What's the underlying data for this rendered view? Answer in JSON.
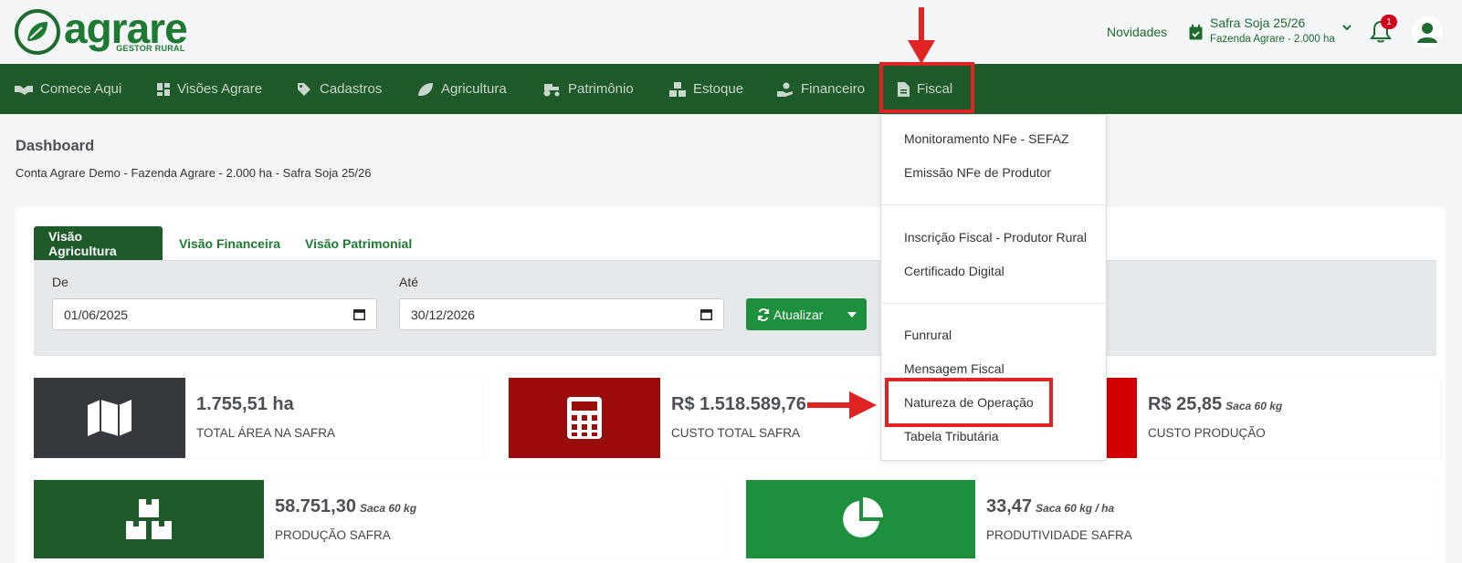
{
  "brand": {
    "name": "agrare",
    "tagline": "GESTOR RURAL"
  },
  "header": {
    "novidades": "Novidades",
    "safra": {
      "title": "Safra Soja 25/26",
      "farm": "Fazenda Agrare - 2.000 ha"
    },
    "notifications_count": "1"
  },
  "nav": {
    "items": [
      {
        "label": "Comece Aqui",
        "icon": "handshake-icon"
      },
      {
        "label": "Visões Agrare",
        "icon": "grid-icon"
      },
      {
        "label": "Cadastros",
        "icon": "tags-icon"
      },
      {
        "label": "Agricultura",
        "icon": "leaf-icon"
      },
      {
        "label": "Patrimônio",
        "icon": "tractor-icon"
      },
      {
        "label": "Estoque",
        "icon": "boxes-icon"
      },
      {
        "label": "Financeiro",
        "icon": "hand-money-icon"
      },
      {
        "label": "Fiscal",
        "icon": "file-invoice-icon"
      }
    ]
  },
  "fiscal_menu": {
    "groups": [
      [
        "Monitoramento NFe - SEFAZ",
        "Emissão NFe de Produtor"
      ],
      [
        "Inscrição Fiscal - Produtor Rural",
        "Certificado Digital"
      ],
      [
        "Funrural",
        "Mensagem Fiscal",
        "Natureza de Operação",
        "Tabela Tributária"
      ]
    ]
  },
  "page": {
    "title": "Dashboard",
    "subtitle": "Conta Agrare Demo - Fazenda Agrare - 2.000 ha - Safra Soja 25/26"
  },
  "tabs": [
    "Visão Agricultura",
    "Visão Financeira",
    "Visão Patrimonial"
  ],
  "filters": {
    "from_label": "De",
    "from_value": "01/06/2025",
    "to_label": "Até",
    "to_value": "30/12/2026",
    "refresh_label": "Atualizar"
  },
  "stats": [
    {
      "value": "1.755,51 ha",
      "unit": "",
      "label": "TOTAL ÁREA NA SAFRA",
      "color": "#35383d",
      "icon": "map-icon"
    },
    {
      "value": "R$ 1.518.589,76",
      "unit": "",
      "label": "CUSTO TOTAL SAFRA",
      "color": "#9b0b0b",
      "icon": "calculator-icon"
    },
    {
      "value": "R$ 25,85",
      "unit": "Saca 60 kg",
      "label": "CUSTO PRODUÇÃO",
      "color": "#d10000",
      "icon": ""
    },
    {
      "value": "58.751,30",
      "unit": "Saca 60 kg",
      "label": "PRODUÇÃO SAFRA",
      "color": "#1f5b2a",
      "icon": "boxes-icon"
    },
    {
      "value": "33,47",
      "unit": "Saca 60 kg / ha",
      "label": "PRODUTIVIDADE SAFRA",
      "color": "#1e8f3c",
      "icon": "pie-chart-icon"
    }
  ]
}
